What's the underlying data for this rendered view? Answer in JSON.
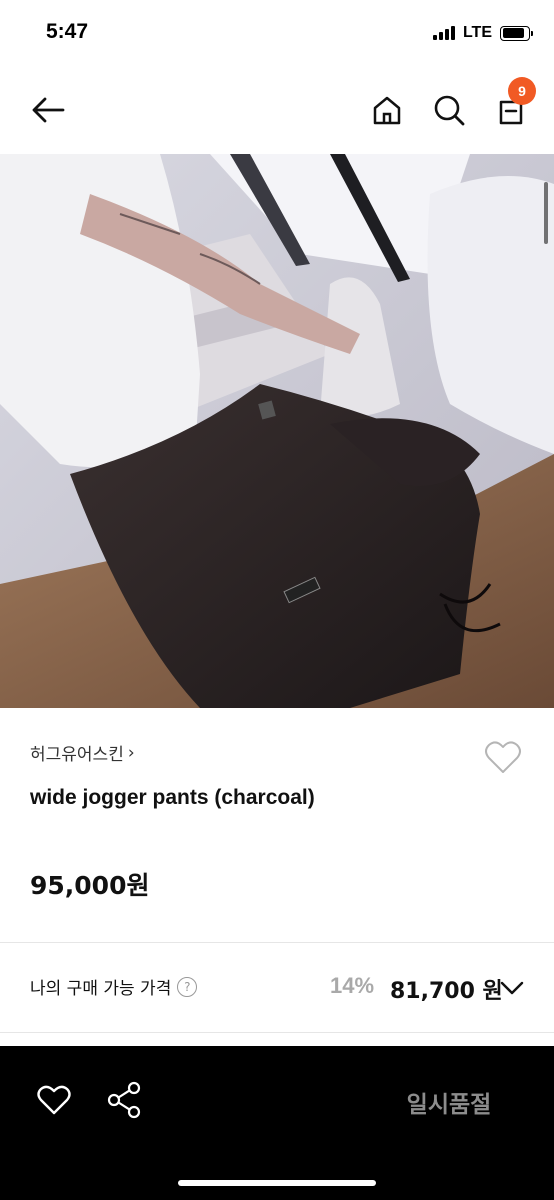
{
  "status_bar": {
    "time": "5:47",
    "network": "LTE",
    "battery_level": 0.85
  },
  "nav": {
    "back_icon": "arrow-left-icon",
    "home_icon": "home-icon",
    "search_icon": "search-icon",
    "cart_icon": "shopping-bag-icon",
    "cart_count": "9",
    "badge_color": "#f15a24"
  },
  "product": {
    "image_description_icon": "product-photo",
    "brand": "허그유어스킨",
    "brand_chevron": "›",
    "name": "wide jogger pants (charcoal)",
    "price": "95,000원"
  },
  "my_price": {
    "label": "나의 구매 가능 가격",
    "help": "?",
    "discount": "14%",
    "price": "81,700 원"
  },
  "bottom_bar": {
    "sold_out_label": "일시품절",
    "background": "#000000"
  }
}
